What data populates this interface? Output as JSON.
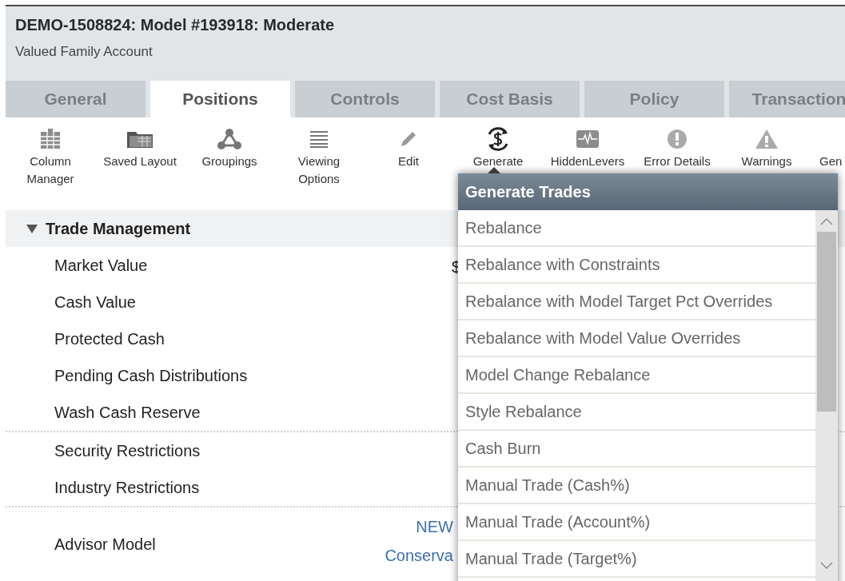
{
  "header": {
    "title": "DEMO-1508824: Model #193918: Moderate",
    "subtitle": "Valued Family Account"
  },
  "tabs": [
    {
      "label": "General",
      "selected": false
    },
    {
      "label": "Positions",
      "selected": true
    },
    {
      "label": "Controls",
      "selected": false
    },
    {
      "label": "Cost Basis",
      "selected": false
    },
    {
      "label": "Policy",
      "selected": false
    },
    {
      "label": "Transaction",
      "selected": false
    }
  ],
  "toolbar": [
    {
      "kind": "grid",
      "label": "Column Manager"
    },
    {
      "kind": "folder",
      "label": "Saved Layout"
    },
    {
      "kind": "nodes",
      "label": "Groupings"
    },
    {
      "kind": "lines",
      "label": "Viewing Options"
    },
    {
      "kind": "pencil",
      "label": "Edit"
    },
    {
      "kind": "dollar",
      "label": "Generate"
    },
    {
      "kind": "pulse",
      "label": "HiddenLevers"
    },
    {
      "kind": "error",
      "label": "Error Details"
    },
    {
      "kind": "warning",
      "label": "Warnings"
    },
    {
      "kind": "none",
      "label": "Gen"
    }
  ],
  "section": {
    "title": "Trade Management",
    "expanded": true,
    "groups": [
      [
        {
          "label": "Market Value",
          "value": "$"
        },
        {
          "label": "Cash Value"
        },
        {
          "label": "Protected Cash"
        },
        {
          "label": "Pending Cash Distributions"
        },
        {
          "label": "Wash Cash Reserve"
        }
      ],
      [
        {
          "label": "Security Restrictions"
        },
        {
          "label": "Industry Restrictions"
        }
      ],
      [
        {
          "label": "Advisor Model",
          "links": [
            "NEW",
            "Conserva"
          ]
        }
      ]
    ]
  },
  "dropdown": {
    "title": "Generate Trades",
    "items": [
      "Rebalance",
      "Rebalance with Constraints",
      "Rebalance with Model Target Pct Overrides",
      "Rebalance with Model Value Overrides",
      "Model Change Rebalance",
      "Style Rebalance",
      "Cash Burn",
      "Manual Trade (Cash%)",
      "Manual Trade (Account%)",
      "Manual Trade (Target%)"
    ]
  }
}
